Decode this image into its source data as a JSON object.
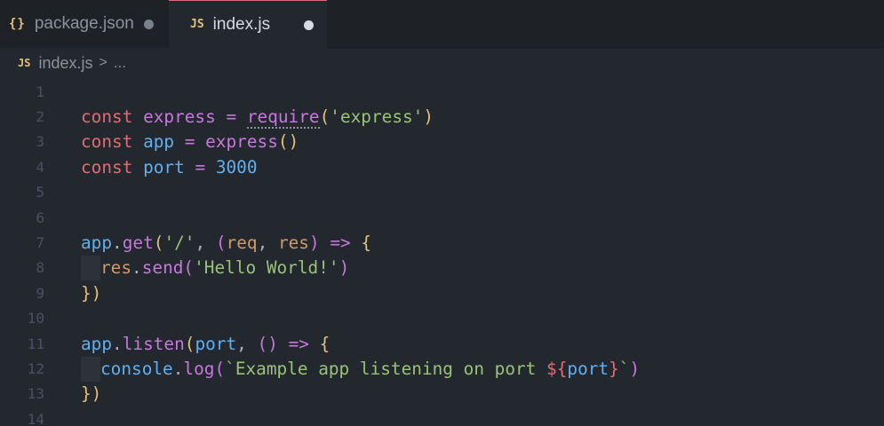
{
  "tabs": [
    {
      "label": "package.json",
      "icon": "json-file-icon",
      "icon_text": "{}",
      "active": false,
      "modified": true
    },
    {
      "label": "index.js",
      "icon": "javascript-file-icon",
      "icon_text": "JS",
      "active": true,
      "modified": true
    }
  ],
  "breadcrumb": {
    "icon_text": "JS",
    "file": "index.js",
    "separator": ">",
    "more": "..."
  },
  "code": {
    "line_numbers": [
      "1",
      "2",
      "3",
      "4",
      "5",
      "6",
      "7",
      "8",
      "9",
      "10",
      "11",
      "12",
      "13",
      "14"
    ],
    "lines": [
      [],
      [
        {
          "t": "const",
          "c": "kw"
        },
        {
          "t": " "
        },
        {
          "t": "express",
          "c": "var"
        },
        {
          "t": " "
        },
        {
          "t": "=",
          "c": "op"
        },
        {
          "t": " "
        },
        {
          "t": "require",
          "c": "req"
        },
        {
          "t": "(",
          "c": "p1"
        },
        {
          "t": "'express'",
          "c": "str"
        },
        {
          "t": ")",
          "c": "p1"
        }
      ],
      [
        {
          "t": "const",
          "c": "kw"
        },
        {
          "t": " "
        },
        {
          "t": "app",
          "c": "vb"
        },
        {
          "t": " "
        },
        {
          "t": "=",
          "c": "op"
        },
        {
          "t": " "
        },
        {
          "t": "express",
          "c": "var"
        },
        {
          "t": "()",
          "c": "p1"
        }
      ],
      [
        {
          "t": "const",
          "c": "kw"
        },
        {
          "t": " "
        },
        {
          "t": "port",
          "c": "vb"
        },
        {
          "t": " "
        },
        {
          "t": "=",
          "c": "op"
        },
        {
          "t": " "
        },
        {
          "t": "3000",
          "c": "fn"
        }
      ],
      [],
      [],
      [
        {
          "t": "app",
          "c": "vb"
        },
        {
          "t": ".",
          "c": "plain"
        },
        {
          "t": "get",
          "c": "var"
        },
        {
          "t": "(",
          "c": "p1"
        },
        {
          "t": "'/'",
          "c": "str"
        },
        {
          "t": ",",
          "c": "plain"
        },
        {
          "t": " "
        },
        {
          "t": "(",
          "c": "p2"
        },
        {
          "t": "req",
          "c": "num"
        },
        {
          "t": ",",
          "c": "plain"
        },
        {
          "t": " "
        },
        {
          "t": "res",
          "c": "num"
        },
        {
          "t": ")",
          "c": "p2"
        },
        {
          "t": " "
        },
        {
          "t": "=>",
          "c": "op"
        },
        {
          "t": " "
        },
        {
          "t": "{",
          "c": "p1"
        }
      ],
      [
        {
          "indent": true
        },
        {
          "t": "res",
          "c": "num"
        },
        {
          "t": ".",
          "c": "plain"
        },
        {
          "t": "send",
          "c": "var"
        },
        {
          "t": "(",
          "c": "p2"
        },
        {
          "t": "'Hello World!'",
          "c": "str"
        },
        {
          "t": ")",
          "c": "p2"
        }
      ],
      [
        {
          "t": "})",
          "c": "p1"
        }
      ],
      [],
      [
        {
          "t": "app",
          "c": "vb"
        },
        {
          "t": ".",
          "c": "plain"
        },
        {
          "t": "listen",
          "c": "var"
        },
        {
          "t": "(",
          "c": "p1"
        },
        {
          "t": "port",
          "c": "vb"
        },
        {
          "t": ",",
          "c": "plain"
        },
        {
          "t": " "
        },
        {
          "t": "()",
          "c": "p2"
        },
        {
          "t": " "
        },
        {
          "t": "=>",
          "c": "op"
        },
        {
          "t": " "
        },
        {
          "t": "{",
          "c": "p1"
        }
      ],
      [
        {
          "indent": true
        },
        {
          "t": "console",
          "c": "vb"
        },
        {
          "t": ".",
          "c": "plain"
        },
        {
          "t": "log",
          "c": "var"
        },
        {
          "t": "(",
          "c": "p2"
        },
        {
          "t": "`Example app listening on port ",
          "c": "str"
        },
        {
          "t": "${",
          "c": "kw"
        },
        {
          "t": "port",
          "c": "vb"
        },
        {
          "t": "}",
          "c": "kw"
        },
        {
          "t": "`",
          "c": "str"
        },
        {
          "t": ")",
          "c": "p2"
        }
      ],
      [
        {
          "t": "})",
          "c": "p1"
        }
      ],
      []
    ]
  },
  "colors": {
    "editor_background": "#23272e",
    "tab_background": "#1e2227",
    "active_tab_border": "#e06c75",
    "keyword": "#e06c75",
    "string": "#98c379",
    "function": "#c678dd",
    "variable": "#61afef",
    "bracket": "#e5c07b",
    "line_number": "#495162"
  }
}
